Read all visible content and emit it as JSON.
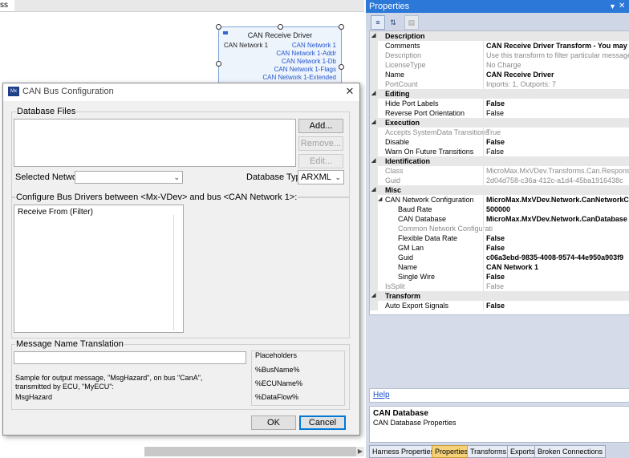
{
  "canvas": {
    "top_tab": "ss",
    "node": {
      "title": "CAN Receive Driver",
      "input_port": "CAN Network 1",
      "output_ports": [
        "CAN Network 1",
        "CAN Network 1-Addr",
        "CAN Network 1-Db",
        "CAN Network 1-Flags",
        "CAN Network 1-Extended"
      ]
    }
  },
  "dialog": {
    "title": "CAN Bus Configuration",
    "icon_text": "Mx",
    "database_files_label": "Database Files",
    "add_button": "Add...",
    "remove_button": "Remove...",
    "edit_button": "Edit...",
    "selected_network_label": "Selected Network:",
    "selected_network_value": "",
    "database_type_label": "Database Type:",
    "database_type_value": "ARXML",
    "configure_label": "Configure Bus Drivers between <Mx-VDev> and bus <CAN Network 1>:",
    "drivers": [
      "Receive From (Filter)"
    ],
    "translation_label": "Message Name Translation",
    "translation_value": "",
    "sample_text": "Sample for output message, \"MsgHazard\", on bus \"CanA\", transmitted by ECU, \"MyECU\":",
    "sample_result": "MsgHazard",
    "placeholders_label": "Placeholders",
    "placeholders": [
      "%BusName%",
      "%ECUName%",
      "%DataFlow%"
    ],
    "ok_button": "OK",
    "cancel_button": "Cancel"
  },
  "properties": {
    "title": "Properties",
    "pin_icon": "pin-icon",
    "close_icon": "close-icon",
    "toolbar": [
      "categorized-icon",
      "alphabetical-icon",
      "property-pages-icon"
    ],
    "rows": [
      {
        "type": "cat",
        "name": "Description"
      },
      {
        "name": "Comments",
        "value": "CAN Receive Driver Transform - You may a",
        "bold": true
      },
      {
        "name": "Description",
        "value": "Use this transform to filter particular messages from a",
        "ro": true
      },
      {
        "name": "LicenseType",
        "value": "No Charge",
        "ro": true
      },
      {
        "name": "Name",
        "value": "CAN Receive Driver",
        "bold": true
      },
      {
        "name": "PortCount",
        "value": "Inports: 1, Outports: 7",
        "ro": true
      },
      {
        "type": "cat",
        "name": "Editing"
      },
      {
        "name": "Hide Port Labels",
        "value": "False",
        "bold": true
      },
      {
        "name": "Reverse Port Orientation",
        "value": "False"
      },
      {
        "type": "cat",
        "name": "Execution"
      },
      {
        "name": "Accepts SystemData Transitions",
        "value": "True",
        "ro": true
      },
      {
        "name": "Disable",
        "value": "False",
        "bold": true
      },
      {
        "name": "Warn On Future Transitions",
        "value": "False"
      },
      {
        "type": "cat",
        "name": "Identification"
      },
      {
        "name": "Class",
        "value": "MicroMax.MxVDev.Transforms.Can.ResponseWeb",
        "ro": true
      },
      {
        "name": "Guid",
        "value": "2d04d758-c36a-412c-a1d4-45ba1916438c",
        "ro": true
      },
      {
        "type": "cat",
        "name": "Misc"
      },
      {
        "name": "CAN Network Configuration",
        "value": "MicroMax.MxVDev.Network.CanNetworkCo",
        "bold": true,
        "expand": true
      },
      {
        "name": "Baud Rate",
        "value": "500000",
        "bold": true,
        "indent": true
      },
      {
        "name": "CAN Database",
        "value": "MicroMax.MxVDev.Network.CanDatabase",
        "bold": true,
        "indent": true
      },
      {
        "name": "Common Network Configurati",
        "value": "",
        "ro": true,
        "indent": true
      },
      {
        "name": "Flexible Data Rate",
        "value": "False",
        "bold": true,
        "indent": true
      },
      {
        "name": "GM Lan",
        "value": "False",
        "bold": true,
        "indent": true
      },
      {
        "name": "Guid",
        "value": "c06a3ebd-9835-4008-9574-44e950a903f9",
        "bold": true,
        "indent": true
      },
      {
        "name": "Name",
        "value": "CAN Network 1",
        "bold": true,
        "indent": true
      },
      {
        "name": "Single Wire",
        "value": "False",
        "bold": true,
        "indent": true
      },
      {
        "name": "IsSplit",
        "value": "False",
        "ro": true
      },
      {
        "type": "cat",
        "name": "Transform"
      },
      {
        "name": "Auto Export Signals",
        "value": "False",
        "bold": true
      }
    ],
    "help_link": "Help",
    "desc_title": "CAN Database",
    "desc_text": "CAN Database Properties",
    "tabs": [
      "Harness Properties",
      "Properties",
      "Transforms",
      "Exports",
      "Broken Connections"
    ],
    "active_tab": 1
  },
  "colors": {
    "title_bar": "#2b78d8",
    "panel_bg": "#d6dbe9",
    "active_tab": "#f5d27a",
    "node_border": "#7aa3d6"
  }
}
